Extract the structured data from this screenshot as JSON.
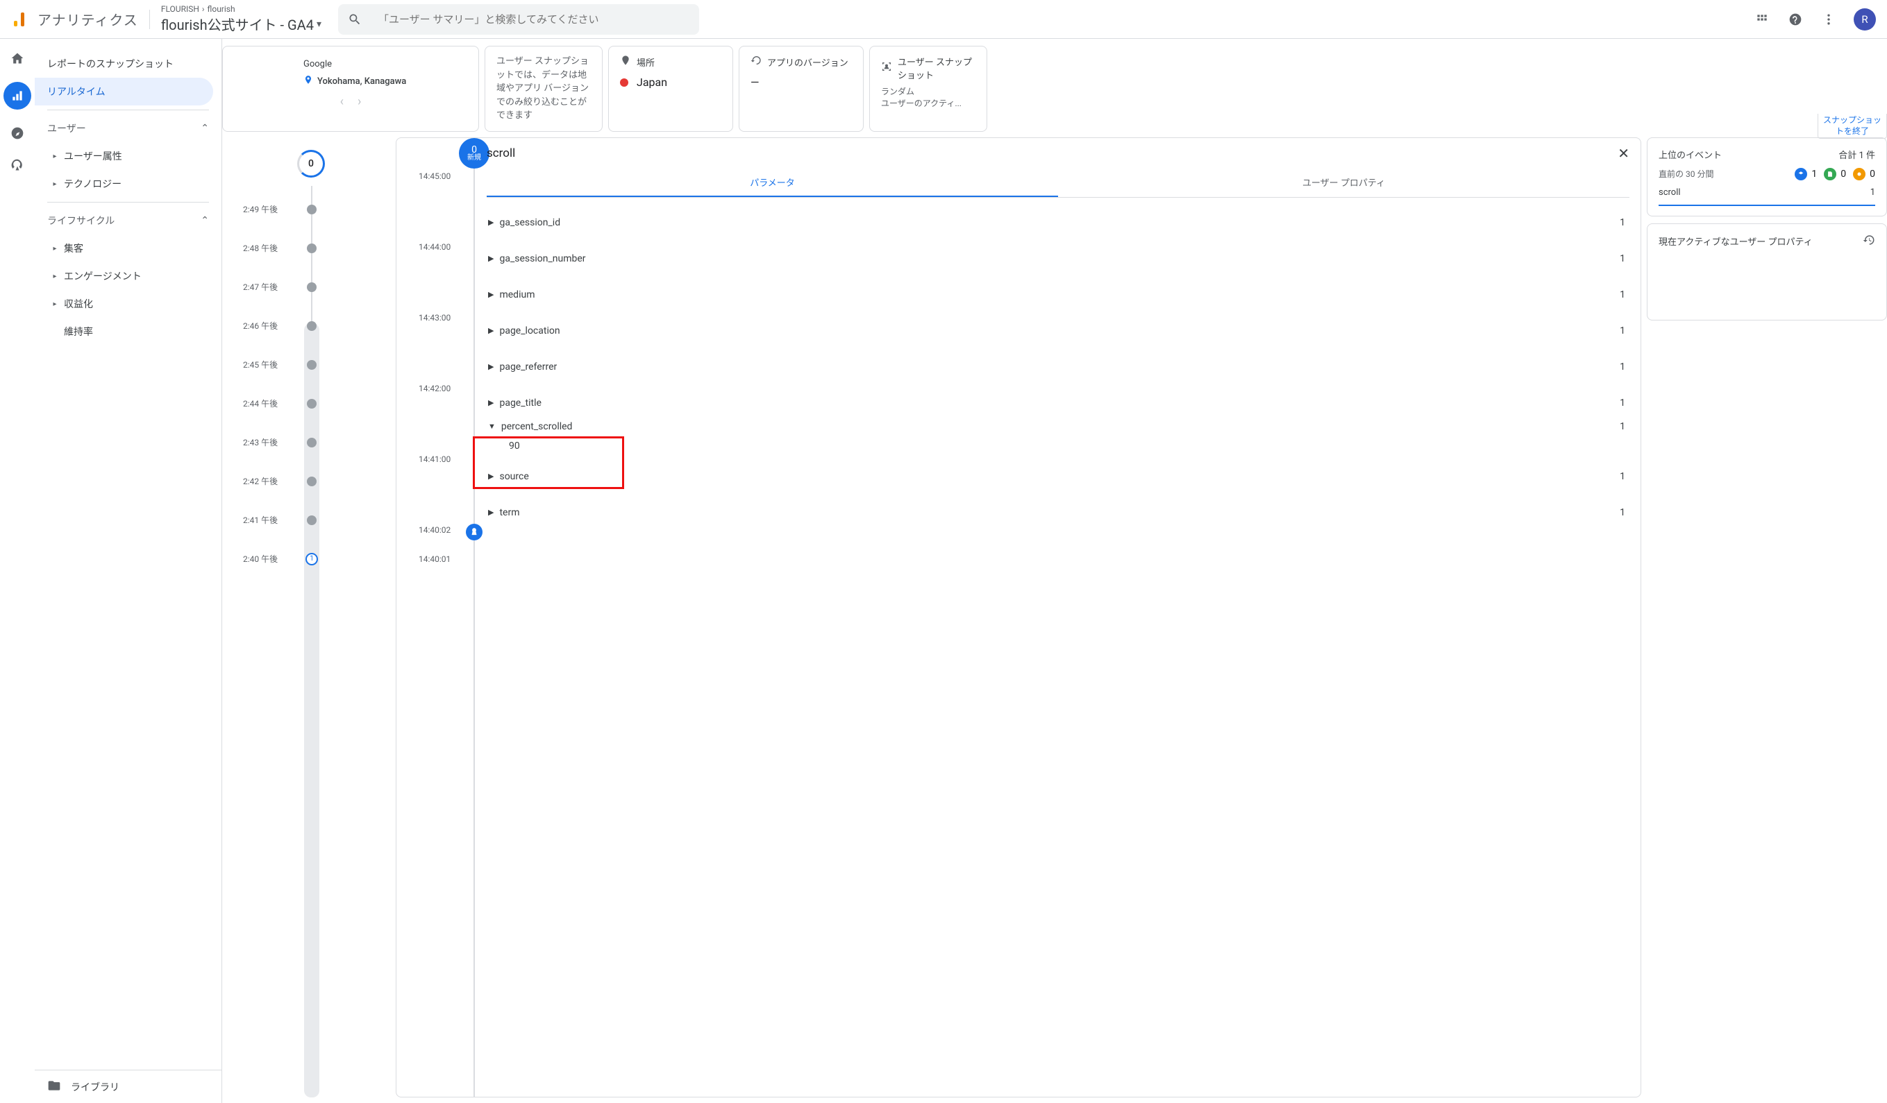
{
  "topbar": {
    "brand": "アナリティクス",
    "breadcrumb_account": "FLOURISH",
    "breadcrumb_property": "flourish",
    "property_title": "flourish公式サイト - GA4",
    "search_placeholder": "「ユーザー サマリー」と検索してみてください",
    "avatar_letter": "R"
  },
  "rail": {},
  "sidenav": {
    "report_snapshot": "レポートのスナップショット",
    "realtime": "リアルタイム",
    "section_user": "ユーザー",
    "user_attr": "ユーザー属性",
    "technology": "テクノロジー",
    "section_lifecycle": "ライフサイクル",
    "acquisition": "集客",
    "engagement": "エンゲージメント",
    "monetization": "収益化",
    "retention": "維持率",
    "library": "ライブラリ"
  },
  "cards": {
    "c1_source": "Google",
    "c1_location": "Yokohama, Kanagawa",
    "c2_text": "ユーザー スナップショットでは、データは地域やアプリ バージョンでのみ絞り込むことができます",
    "c3_label": "場所",
    "c3_value": "Japan",
    "c4_label": "アプリのバージョン",
    "c4_value": "—",
    "c5_label": "ユーザー スナップショット",
    "c5_sub1": "ランダム",
    "c5_sub2": "ユーザーのアクティ...",
    "exit_snapshot": "スナップショットを終了"
  },
  "timeline1": {
    "top_count": "0",
    "rows": [
      {
        "time": "2:49 午後"
      },
      {
        "time": "2:48 午後"
      },
      {
        "time": "2:47 午後"
      },
      {
        "time": "2:46 午後"
      },
      {
        "time": "2:45 午後"
      },
      {
        "time": "2:44 午後"
      },
      {
        "time": "2:43 午後"
      },
      {
        "time": "2:42 午後"
      },
      {
        "time": "2:41 午後"
      },
      {
        "time": "2:40 午後"
      }
    ],
    "last_badge": "1"
  },
  "timeline2": {
    "badge_num": "0",
    "badge_label": "新規",
    "ticks": [
      "14:45:00",
      "14:44:00",
      "14:43:00",
      "14:42:00",
      "14:41:00",
      "14:40:02",
      "14:40:01"
    ]
  },
  "event_panel": {
    "title": "scroll",
    "tab_params": "パラメータ",
    "tab_props": "ユーザー プロパティ",
    "params": [
      {
        "name": "ga_session_id",
        "count": "1"
      },
      {
        "name": "ga_session_number",
        "count": "1"
      },
      {
        "name": "medium",
        "count": "1"
      },
      {
        "name": "page_location",
        "count": "1"
      },
      {
        "name": "page_referrer",
        "count": "1"
      },
      {
        "name": "page_title",
        "count": "1"
      },
      {
        "name": "percent_scrolled",
        "count": "1",
        "expanded": true,
        "value": "90"
      },
      {
        "name": "source",
        "count": "1"
      },
      {
        "name": "term",
        "count": "1"
      }
    ]
  },
  "right": {
    "top_events_label": "上位のイベント",
    "total_label": "合計 1 件",
    "last30_label": "直前の 30 分間",
    "counts": {
      "blue": "1",
      "green": "0",
      "orange": "0"
    },
    "list": [
      {
        "name": "scroll",
        "count": "1"
      }
    ],
    "active_props_label": "現在アクティブなユーザー プロパティ"
  }
}
